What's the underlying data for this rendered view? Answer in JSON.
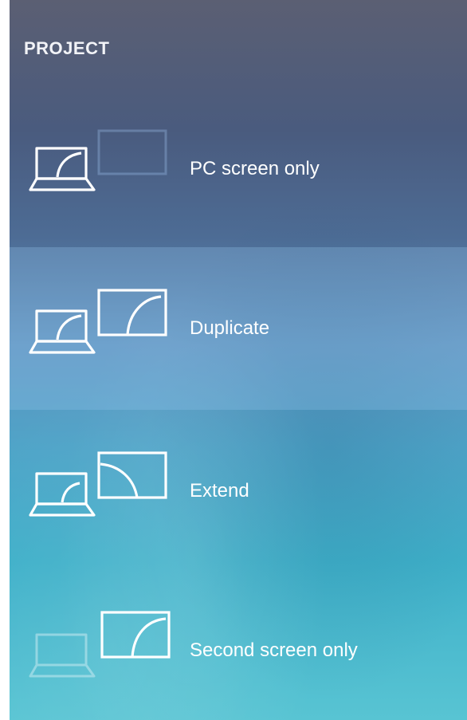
{
  "panel": {
    "title": "PROJECT"
  },
  "options": [
    {
      "label": "PC screen only",
      "icon": "pc-screen-only-icon",
      "selected": false
    },
    {
      "label": "Duplicate",
      "icon": "duplicate-icon",
      "selected": true
    },
    {
      "label": "Extend",
      "icon": "extend-icon",
      "selected": false
    },
    {
      "label": "Second screen only",
      "icon": "second-screen-only-icon",
      "selected": false
    }
  ]
}
